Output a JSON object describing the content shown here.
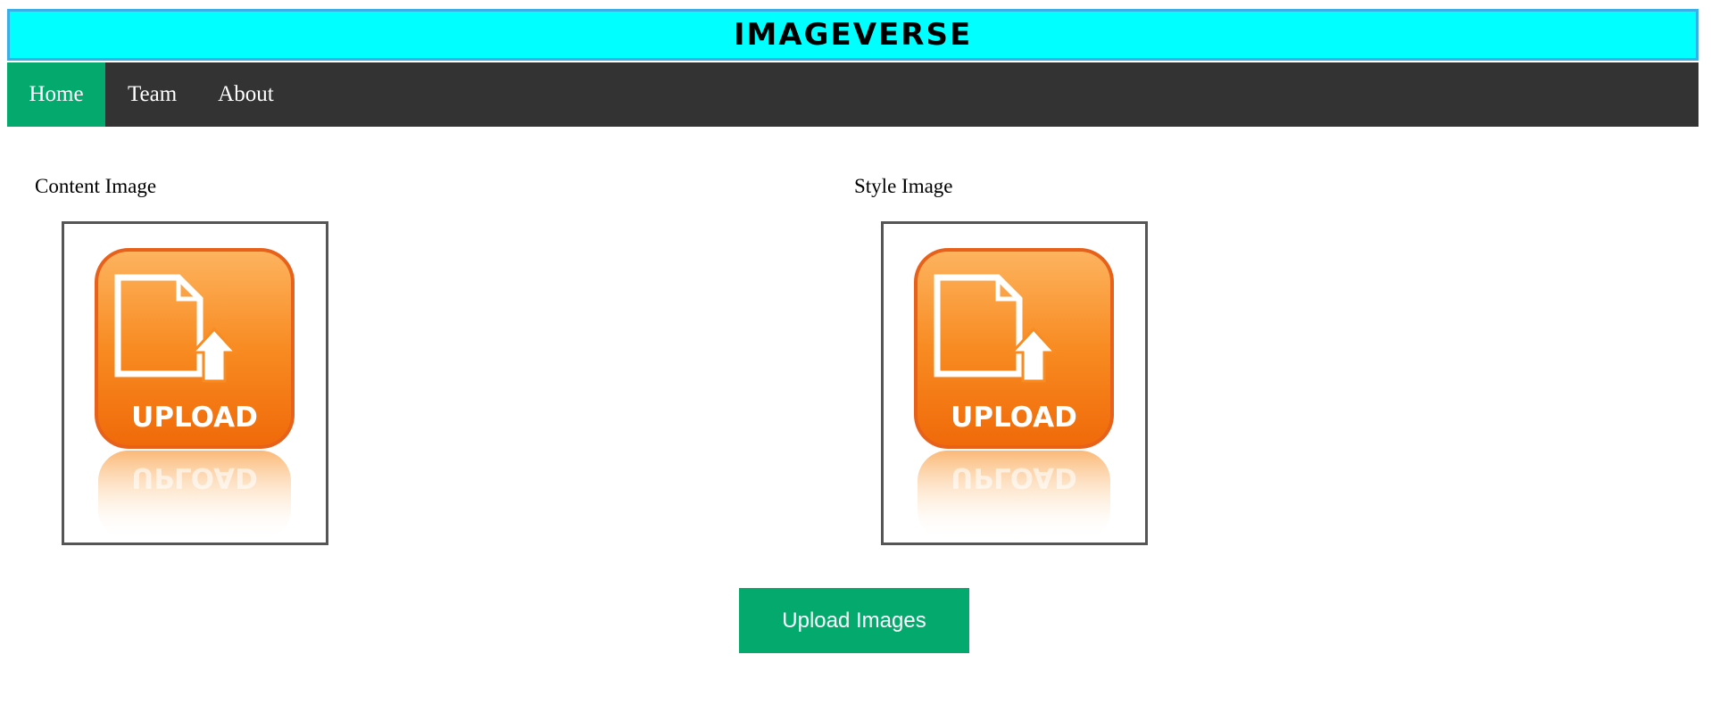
{
  "header": {
    "title": "IMAGEVERSE"
  },
  "nav": {
    "items": [
      {
        "label": "Home",
        "active": true
      },
      {
        "label": "Team",
        "active": false
      },
      {
        "label": "About",
        "active": false
      }
    ]
  },
  "content_image": {
    "label": "Content Image",
    "icon": "upload-icon",
    "icon_text": "UPLOAD"
  },
  "style_image": {
    "label": "Style Image",
    "icon": "upload-icon",
    "icon_text": "UPLOAD"
  },
  "upload_button": {
    "label": "Upload Images"
  },
  "colors": {
    "header_bg": "#00ffff",
    "nav_bg": "#333333",
    "accent": "#04aa6d",
    "icon_orange": "#f7941d"
  }
}
